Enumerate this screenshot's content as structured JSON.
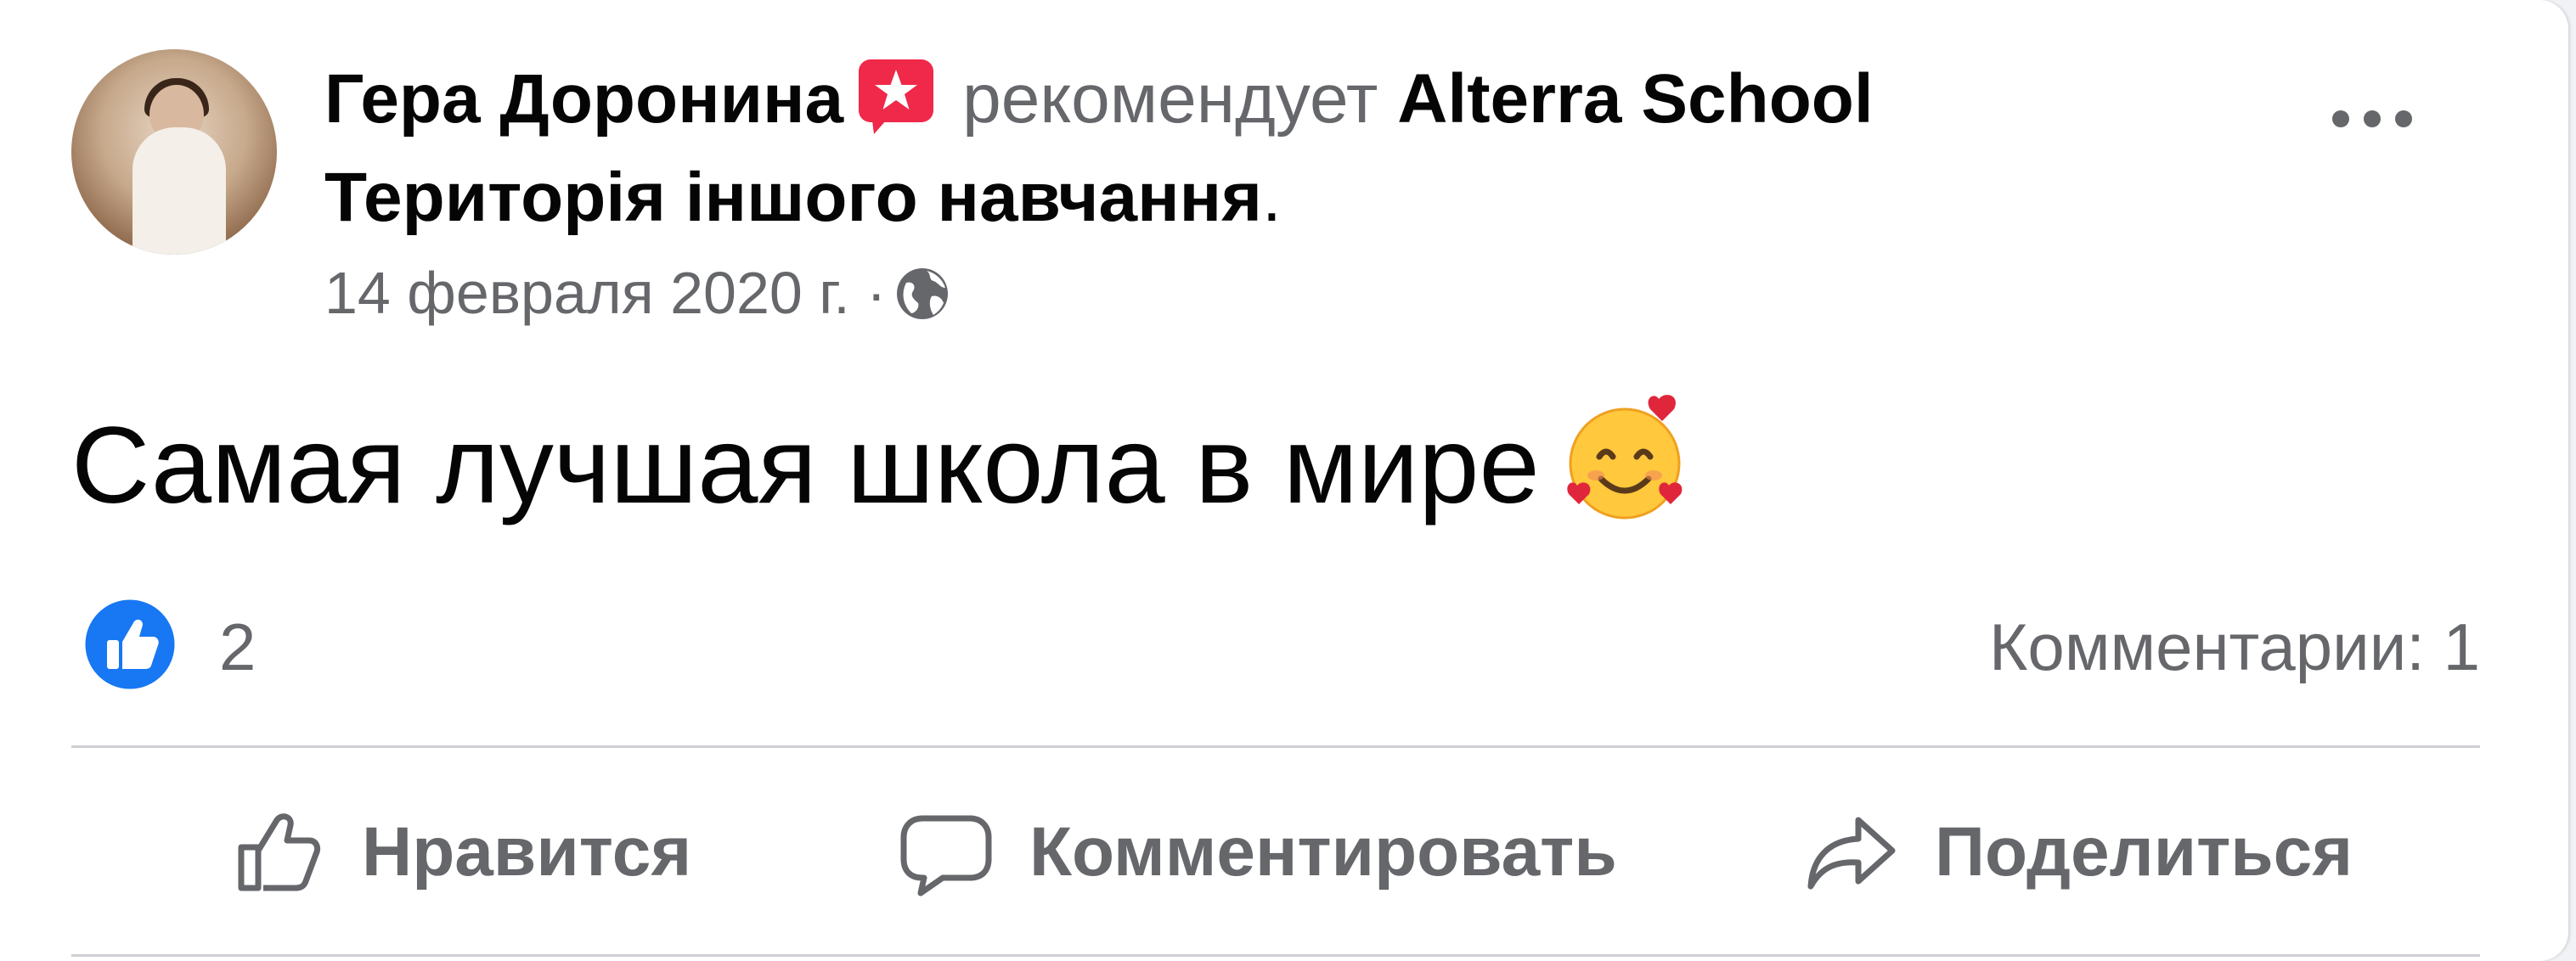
{
  "post": {
    "author": "Гера Доронина",
    "recommends": "рекомендует",
    "page_name_part1": "Alterra School",
    "page_name_part2": "Територія іншого навчання",
    "period": ".",
    "date": "14 февраля 2020 г.",
    "separator": "·",
    "privacy_icon": "globe-icon",
    "text": "Самая лучшая школа в мире",
    "emoji": "smiling-face-with-hearts"
  },
  "stats": {
    "likes": "2",
    "comments": "Комментарии: 1"
  },
  "actions": {
    "like": "Нравится",
    "comment": "Комментировать",
    "share": "Поделиться"
  },
  "colors": {
    "like_blue": "#1877f2",
    "recommend_red": "#f02849",
    "text_secondary": "#65676b"
  }
}
